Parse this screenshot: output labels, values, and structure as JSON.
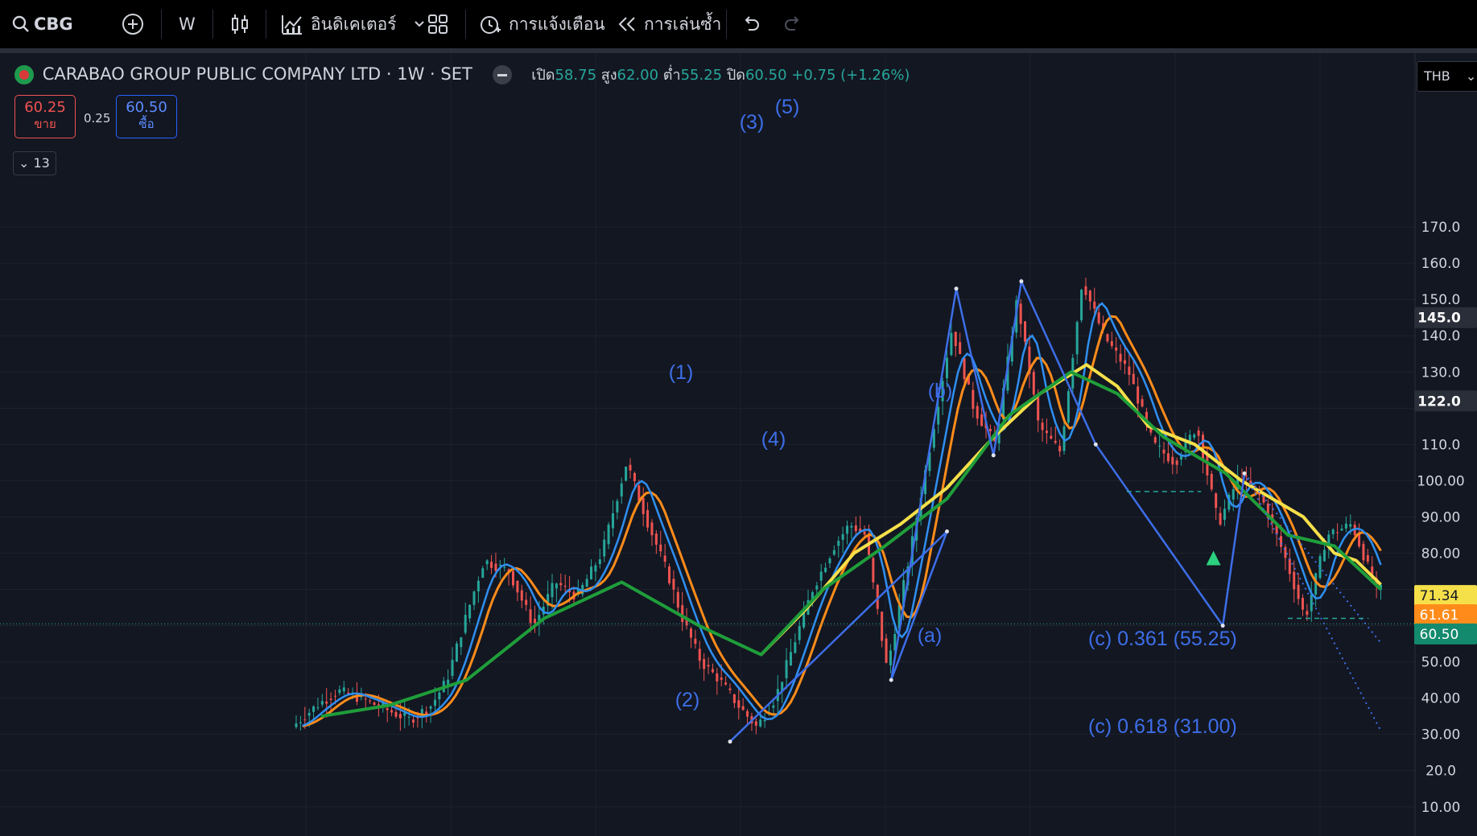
{
  "toolbar": {
    "symbol": "CBG",
    "interval": "W",
    "indicators_label": "อินดิเคเตอร์",
    "alerts_label": "การแจ้งเตือน",
    "replay_label": "การเล่นซ้ำ"
  },
  "legend": {
    "title": "CARABAO GROUP PUBLIC COMPANY LTD · 1W · SET",
    "open_label": "เปิด",
    "open": "58.75",
    "high_label": "สูง",
    "high": "62.00",
    "low_label": "ต่ำ",
    "low": "55.25",
    "close_label": "ปิด",
    "close": "60.50",
    "change": "+0.75 (+1.26%)",
    "sell_price": "60.25",
    "sell_label": "ขาย",
    "spread": "0.25",
    "buy_price": "60.50",
    "buy_label": "ซื้อ",
    "indicators_count": "13",
    "currency": "THB"
  },
  "colors": {
    "background": "#131722",
    "wave_blue": "#3d6ee8",
    "candle_up": "#26a69a",
    "candle_down": "#ef5350",
    "ma_yellow": "#f5e04a",
    "ma_orange": "#ff8c1a",
    "ma_green": "#1f9e3a",
    "ma_blue": "#2f8ff0"
  },
  "chart_data": {
    "type": "line",
    "title": "CARABAO GROUP PUBLIC COMPANY LTD · 1W · SET",
    "ylim": [
      0,
      175
    ],
    "y_ticks": [
      "170.0",
      "160.0",
      "150.0",
      "140.0",
      "130.0",
      "110.0",
      "100.00",
      "90.00",
      "80.00",
      "50.00",
      "40.00",
      "30.00",
      "20.0",
      "10.00"
    ],
    "axis_markers": [
      {
        "label": "145.0",
        "value": 145.0,
        "style": "dark"
      },
      {
        "label": "122.0",
        "value": 122.0,
        "style": "dark"
      },
      {
        "label": "71.34",
        "value": 71.34,
        "style": "yellow"
      },
      {
        "label": "61.61",
        "value": 61.61,
        "style": "orange"
      },
      {
        "label": "60.50",
        "value": 60.5,
        "style": "green"
      }
    ],
    "last_price": 60.5,
    "price_path": {
      "t": [
        0,
        8,
        15,
        22,
        30,
        38,
        45,
        50,
        56,
        62,
        70,
        78,
        85,
        92,
        100,
        108,
        115,
        121,
        126,
        132,
        138,
        144,
        150,
        156,
        162,
        168,
        175,
        180,
        185,
        192,
        199,
        206,
        213,
        220,
        227,
        234,
        241,
        248,
        255,
        262,
        270,
        278,
        285,
        292,
        299,
        306,
        313,
        320,
        327,
        334,
        342,
        350
      ],
      "price": [
        32,
        38,
        42,
        40,
        37,
        34,
        38,
        45,
        62,
        78,
        75,
        60,
        72,
        68,
        80,
        105,
        88,
        75,
        62,
        50,
        45,
        38,
        32,
        40,
        55,
        70,
        82,
        88,
        85,
        48,
        78,
        110,
        142,
        120,
        110,
        150,
        115,
        108,
        155,
        140,
        130,
        110,
        105,
        115,
        88,
        102,
        95,
        80,
        62,
        85,
        88,
        70,
        62,
        78,
        80,
        75,
        58
      ]
    },
    "ma_series": [
      {
        "color_key": "ma_yellow",
        "t": [
          150,
          165,
          180,
          195,
          210,
          225,
          240,
          255,
          265,
          275,
          290,
          305,
          315,
          325,
          335,
          342,
          350
        ],
        "v": [
          52,
          65,
          80,
          88,
          98,
          112,
          124,
          132,
          126,
          115,
          110,
          100,
          95,
          90,
          80,
          78,
          71.34
        ]
      },
      {
        "color_key": "ma_green",
        "t": [
          8,
          30,
          55,
          80,
          105,
          130,
          150,
          170,
          190,
          210,
          230,
          250,
          265,
          280,
          300,
          320,
          335,
          350
        ],
        "v": [
          35,
          38,
          45,
          62,
          72,
          60,
          52,
          70,
          82,
          95,
          118,
          130,
          124,
          112,
          102,
          85,
          82,
          70
        ]
      }
    ],
    "elliott_waves": [
      {
        "label": "(1)",
        "price_anchor": 108,
        "t": 206
      },
      {
        "label": "(2)",
        "price_anchor": 31,
        "t": 192
      },
      {
        "label": "(3)",
        "price_anchor": 162,
        "t": 213
      },
      {
        "label": "(4)",
        "price_anchor": 90,
        "t": 227
      },
      {
        "label": "(5)",
        "price_anchor": 165,
        "t": 234
      },
      {
        "label": "(a)",
        "price_anchor": 46,
        "t": 299
      },
      {
        "label": "(b)",
        "price_anchor": 103,
        "t": 306
      }
    ],
    "fib_targets": [
      {
        "label": "(c) 0.361 (55.25)",
        "value": 55.25
      },
      {
        "label": "(c) 0.618 (31.00)",
        "value": 31.0
      }
    ],
    "wave_line": [
      {
        "t": 140,
        "price": 28
      },
      {
        "t": 210,
        "price": 86
      },
      {
        "t": 192,
        "price": 45
      },
      {
        "t": 213,
        "price": 153
      },
      {
        "t": 225,
        "price": 107
      },
      {
        "t": 234,
        "price": 155
      },
      {
        "t": 258,
        "price": 110
      },
      {
        "t": 299,
        "price": 60
      },
      {
        "t": 306,
        "price": 102
      }
    ]
  }
}
